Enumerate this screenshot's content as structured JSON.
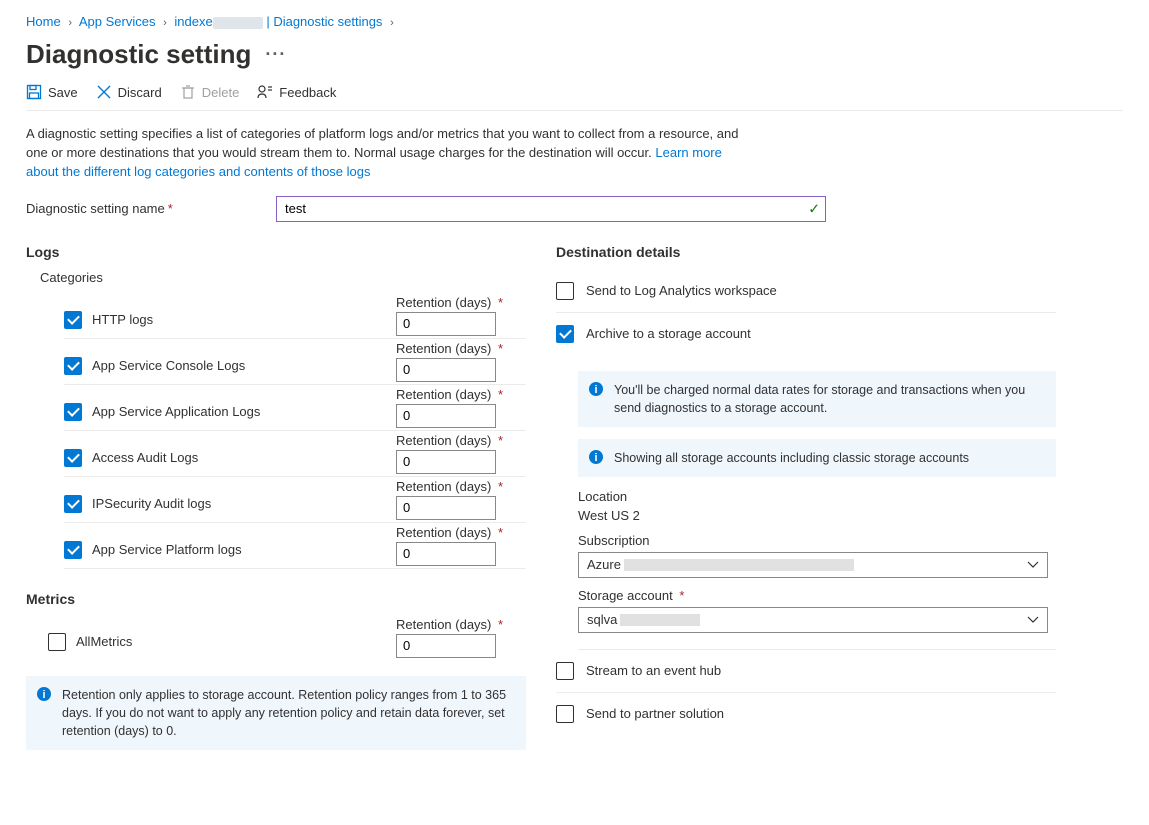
{
  "breadcrumb": {
    "home": "Home",
    "app_services": "App Services",
    "resource_prefix": "indexe",
    "resource_suffix": " | Diagnostic settings"
  },
  "page_title": "Diagnostic setting",
  "ellipsis": "···",
  "toolbar": {
    "save": "Save",
    "discard": "Discard",
    "delete": "Delete",
    "feedback": "Feedback"
  },
  "intro": {
    "text": "A diagnostic setting specifies a list of categories of platform logs and/or metrics that you want to collect from a resource, and one or more destinations that you would stream them to. Normal usage charges for the destination will occur. ",
    "link": "Learn more about the different log categories and contents of those logs"
  },
  "name_field": {
    "label": "Diagnostic setting name",
    "value": "test"
  },
  "logs": {
    "title": "Logs",
    "categories_label": "Categories",
    "retention_label": "Retention (days)",
    "items": [
      {
        "label": "HTTP logs",
        "checked": true,
        "retention": "0"
      },
      {
        "label": "App Service Console Logs",
        "checked": true,
        "retention": "0"
      },
      {
        "label": "App Service Application Logs",
        "checked": true,
        "retention": "0"
      },
      {
        "label": "Access Audit Logs",
        "checked": true,
        "retention": "0"
      },
      {
        "label": "IPSecurity Audit logs",
        "checked": true,
        "retention": "0"
      },
      {
        "label": "App Service Platform logs",
        "checked": true,
        "retention": "0"
      }
    ]
  },
  "metrics": {
    "title": "Metrics",
    "item_label": "AllMetrics",
    "retention": "0"
  },
  "retention_info": "Retention only applies to storage account. Retention policy ranges from 1 to 365 days. If you do not want to apply any retention policy and retain data forever, set retention (days) to 0.",
  "dest": {
    "title": "Destination details",
    "log_analytics": "Send to Log Analytics workspace",
    "archive": "Archive to a storage account",
    "stream": "Stream to an event hub",
    "partner": "Send to partner solution",
    "info1": "You'll be charged normal data rates for storage and transactions when you send diagnostics to a storage account.",
    "info2": "Showing all storage accounts including classic storage accounts",
    "location_label": "Location",
    "location_value": "West US 2",
    "subscription_label": "Subscription",
    "subscription_value": "Azure",
    "storage_label": "Storage account",
    "storage_value": "sqlva"
  }
}
